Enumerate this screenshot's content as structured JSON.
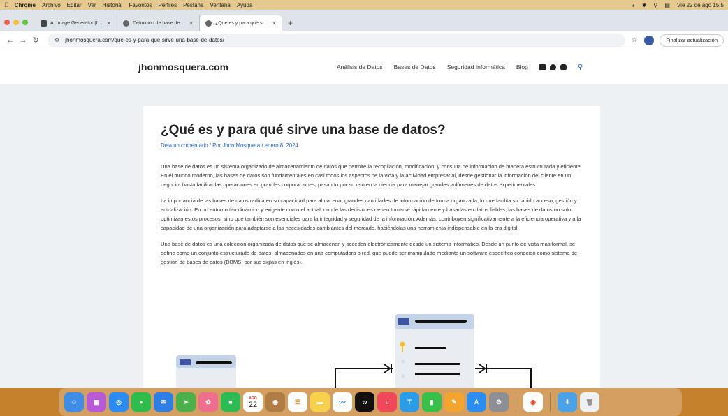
{
  "menubar": {
    "app": "Chrome",
    "items": [
      "Archivo",
      "Editar",
      "Ver",
      "Historial",
      "Favoritos",
      "Perfiles",
      "Pestaña",
      "Ventana",
      "Ayuda"
    ],
    "clock": "Vie 22 de ago 15:5"
  },
  "tabs": [
    {
      "title": "AI Image Generator (free, no",
      "active": false
    },
    {
      "title": "Definición de base de datos",
      "active": false
    },
    {
      "title": "¿Qué es y para qué sirve una",
      "active": true
    }
  ],
  "address": {
    "url": "jhonmosquera.com/que-es-y-para-que-sirve-una-base-de-datos/",
    "update_button": "Finalizar actualización"
  },
  "site": {
    "title": "jhonmosquera.com",
    "nav": [
      "Análisis de Datos",
      "Bases de Datos",
      "Seguridad Informática",
      "Blog"
    ]
  },
  "article": {
    "title": "¿Qué es y para qué sirve una base de datos?",
    "meta": "Deja un comentario / Por Jhon Mosquera / enero 8, 2024",
    "paragraphs": [
      "Una base de datos es un sistema organizado de almacenamiento de datos que permite la recopilación, modificación, y consulta de información de manera estructurada y eficiente. En el mundo moderno, las bases de datos son fundamentales en casi todos los aspectos de la vida y la actividad empresarial, desde gestionar la información del cliente en un negocio, hasta facilitar las operaciones en grandes corporaciones, pasando por su uso en la ciencia para manejar grandes volúmenes de datos experimentales.",
      "La importancia de las bases de datos radica en su capacidad para almacenar grandes cantidades de información de forma organizada, lo que facilita su rápido acceso, gestión y actualización. En un entorno tan dinámico y exigente como el actual, donde las decisiones deben tomarse rápidamente y basadas en datos fiables, las bases de datos no solo optimizan estos procesos, sino que también son esenciales para la integridad y seguridad de la información. Además, contribuyen significativamente a la eficiencia operativa y a la capacidad de una organización para adaptarse a las necesidades cambiantes del mercado, haciéndolas una herramienta indispensable en la era digital.",
      "Una base de datos es una colección organizada de datos que se almacenan y acceden electrónicamente desde un sistema informático. Desde un punto de vista más formal, se define como un conjunto estructurado de datos, almacenados en una computadora o red, que puede ser manipulado mediante un software específico conocido como sistema de gestión de bases de datos (DBMS, por sus siglas en inglés)."
    ]
  },
  "dock": {
    "calendar_month": "AGO",
    "calendar_day": "22",
    "tv_label": "tv"
  }
}
